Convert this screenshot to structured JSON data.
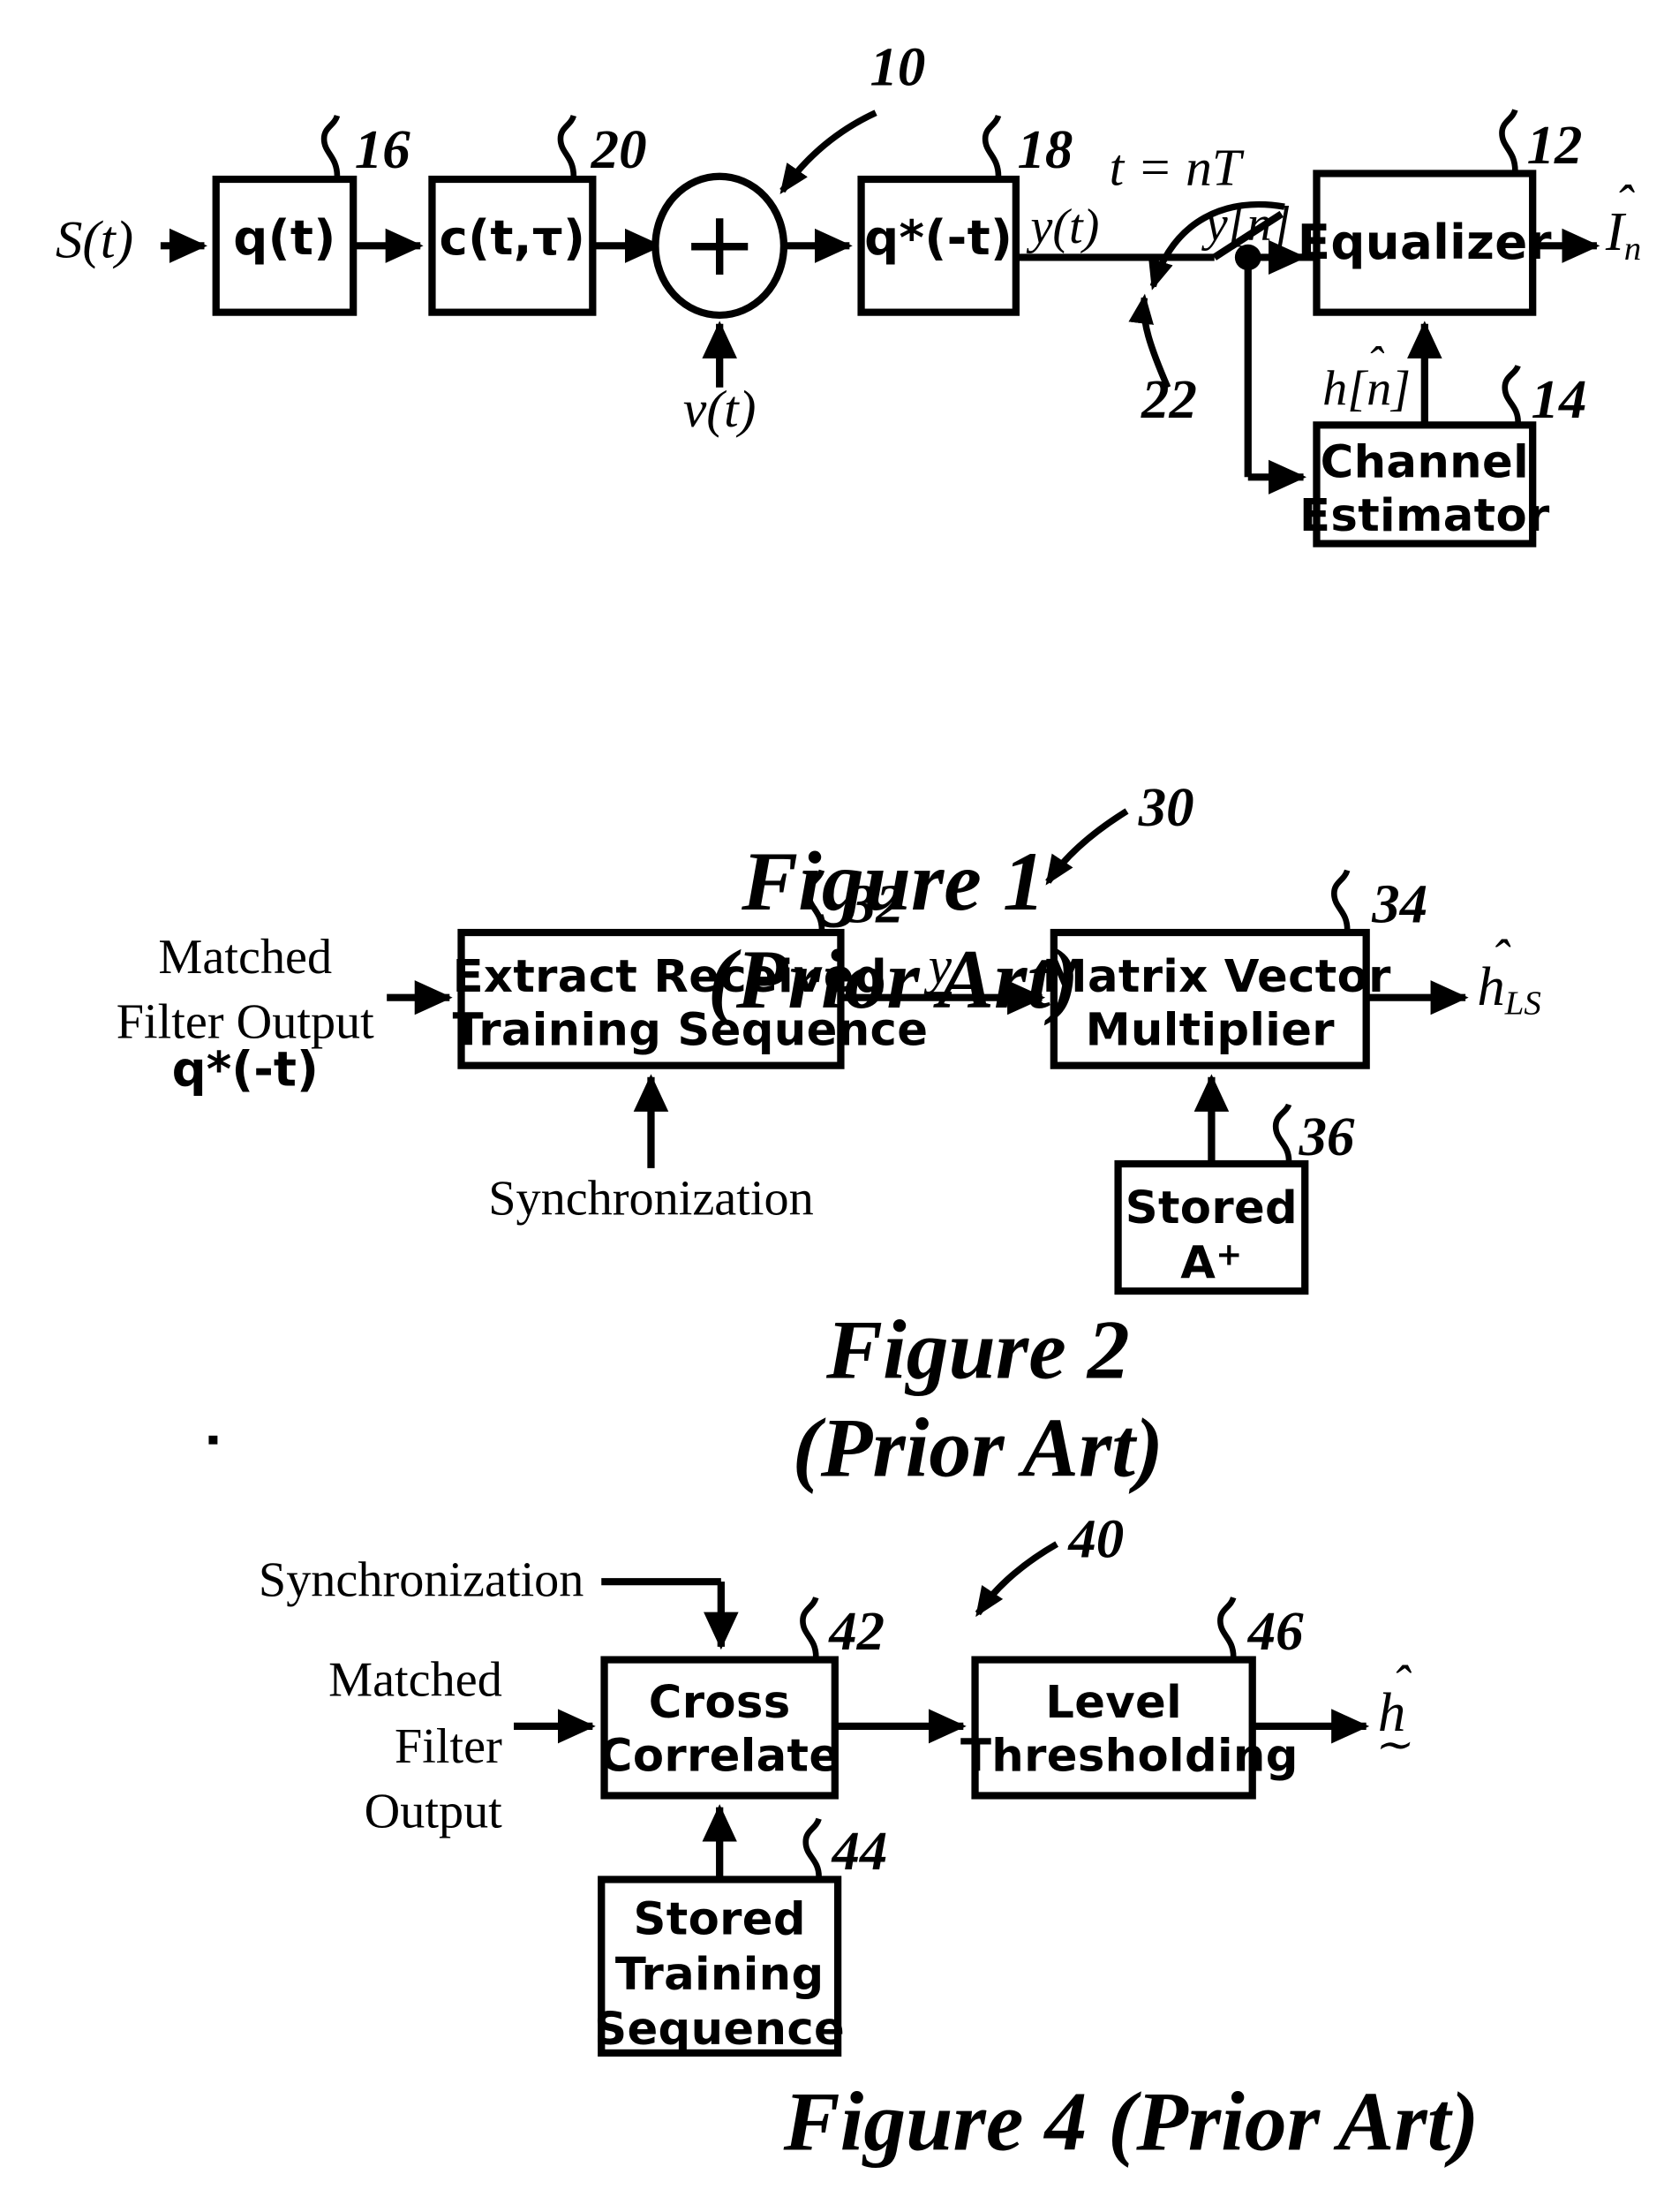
{
  "document": {
    "kind": "patent-drawing-sheet",
    "figures": [
      "Figure 1 (Prior Art)",
      "Figure 2 (Prior Art)",
      "Figure 4 (Prior Art)"
    ]
  },
  "figure1": {
    "caption_line1": "Figure 1",
    "caption_line2": "(Prior Art)",
    "system_ref": "10",
    "input_label": "S(t)",
    "noise_label": "ν(t)",
    "blocks": [
      {
        "label": "q(t)",
        "ref": "16"
      },
      {
        "label": "c(t,τ)",
        "ref": "20"
      },
      {
        "label": "q*(-t)",
        "ref": "18"
      },
      {
        "label_line1": "Equalizer",
        "ref": "12"
      },
      {
        "label_line1": "Channel",
        "label_line2": "Estimator",
        "ref": "14"
      }
    ],
    "summer_symbol": "+",
    "sampler_ref": "22",
    "sampler_label": "t = nT",
    "signal_yt": "y(t)",
    "signal_yn": "y[n]",
    "estimate_hn": "h[n]",
    "output_label": "I",
    "output_sub": "n"
  },
  "figure2": {
    "caption_line1": "Figure 2",
    "caption_line2": "(Prior Art)",
    "system_ref": "30",
    "input_line1": "Matched",
    "input_line2": "Filter Output",
    "input_line3": "q*(-t)",
    "sync_label": "Synchronization",
    "blocks": [
      {
        "label_line1": "Extract Received",
        "label_line2": "Training Sequence",
        "ref": "32"
      },
      {
        "label_line1": "Matrix Vector",
        "label_line2": "Multiplier",
        "ref": "34"
      },
      {
        "label_line1": "Stored",
        "label_line2": "A",
        "label_sup": "+",
        "ref": "36"
      }
    ],
    "mid_signal": "y",
    "output_label": "h",
    "output_sub": "LS"
  },
  "figure4": {
    "caption": "Figure 4 (Prior Art)",
    "system_ref": "40",
    "sync_label": "Synchronization",
    "input_line1": "Matched",
    "input_line2": "Filter",
    "input_line3": "Output",
    "blocks": [
      {
        "label_line1": "Cross",
        "label_line2": "Correlate",
        "ref": "42"
      },
      {
        "label_line1": "Level",
        "label_line2": "Thresholding",
        "ref": "46"
      },
      {
        "label_line1": "Stored",
        "label_line2": "Training",
        "label_line3": "Sequence",
        "ref": "44"
      }
    ],
    "output_label": "h"
  },
  "colors": {
    "ink": "#000000",
    "paper": "#ffffff"
  }
}
